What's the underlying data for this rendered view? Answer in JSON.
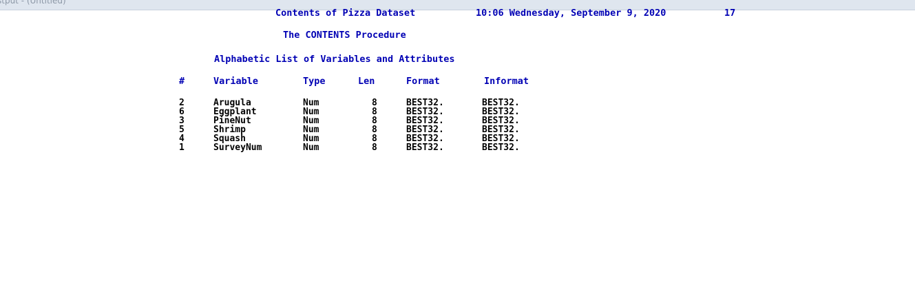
{
  "window": {
    "title": "stput - (Untitled)"
  },
  "output": {
    "header_title": "Contents of Pizza Dataset",
    "header_datetime": "10:06 Wednesday, September 9, 2020",
    "header_page": "17",
    "procedure_title": "The CONTENTS Procedure",
    "section_title": "Alphabetic List of Variables and Attributes",
    "columns": [
      "#",
      "Variable",
      "Type",
      "Len",
      "Format",
      "Informat"
    ],
    "rows": [
      [
        "2",
        "Arugula",
        "Num",
        "8",
        "BEST32.",
        "BEST32."
      ],
      [
        "6",
        "Eggplant",
        "Num",
        "8",
        "BEST32.",
        "BEST32."
      ],
      [
        "3",
        "PineNut",
        "Num",
        "8",
        "BEST32.",
        "BEST32."
      ],
      [
        "5",
        "Shrimp",
        "Num",
        "8",
        "BEST32.",
        "BEST32."
      ],
      [
        "4",
        "Squash",
        "Num",
        "8",
        "BEST32.",
        "BEST32."
      ],
      [
        "1",
        "SurveyNum",
        "Num",
        "8",
        "BEST32.",
        "BEST32."
      ]
    ]
  }
}
